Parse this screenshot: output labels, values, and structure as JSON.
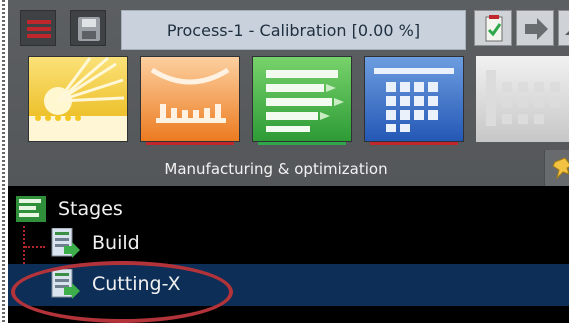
{
  "toolbar": {
    "title": "Process-1 - Calibration [0.00 %]",
    "icons": [
      "menu-icon",
      "save-icon",
      "report-icon",
      "arrow-right-icon",
      "extra-icon"
    ]
  },
  "modules": [
    {
      "name": "calibration",
      "icon": "sunburst-icon",
      "underline_color": ""
    },
    {
      "name": "build",
      "icon": "arc-bars-icon",
      "underline_color": "#c0272d"
    },
    {
      "name": "stages",
      "icon": "list-bars-icon",
      "underline_color": "#2ea84a"
    },
    {
      "name": "grid",
      "icon": "grid-icon",
      "underline_color": "#c0272d"
    },
    {
      "name": "disabled",
      "icon": "grid-gray-icon",
      "underline_color": ""
    }
  ],
  "panel": {
    "label": "Manufacturing & optimization"
  },
  "tree": {
    "root": "Stages",
    "items": [
      {
        "label": "Build",
        "selected": false
      },
      {
        "label": "Cutting-X",
        "selected": true
      }
    ]
  },
  "colors": {
    "panel_bg": "#595c5f",
    "title_bg": "#c9d2dc",
    "tree_bg": "#000000",
    "selection_bg": "#0c2e57",
    "annotation": "#b23339"
  }
}
